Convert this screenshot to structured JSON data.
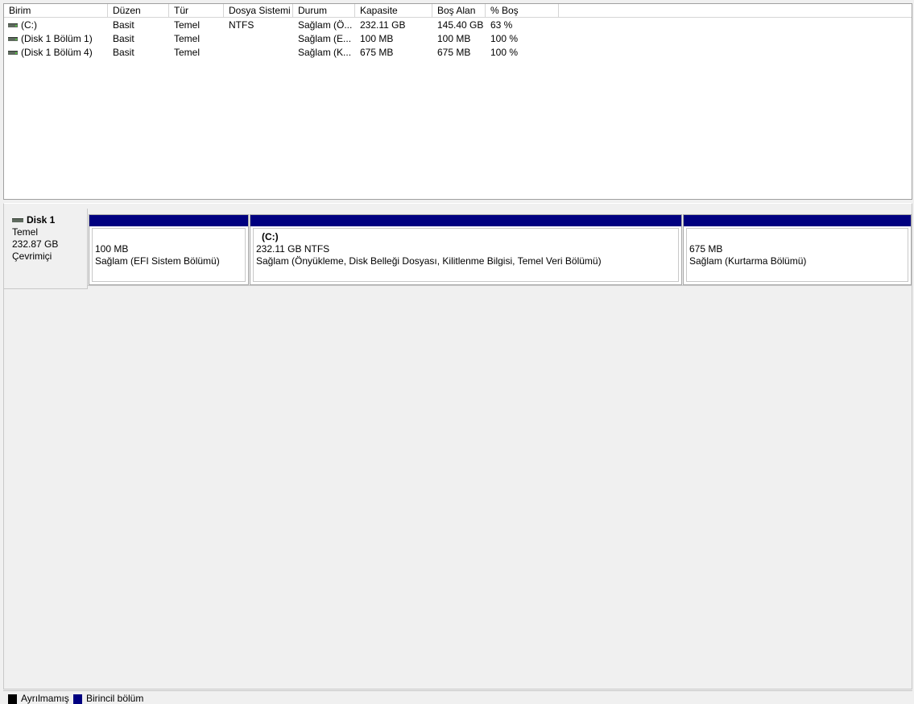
{
  "volume_list": {
    "columns": [
      "Birim",
      "Düzen",
      "Tür",
      "Dosya Sistemi",
      "Durum",
      "Kapasite",
      "Boş Alan",
      "% Boş"
    ],
    "rows": [
      {
        "icon": "volume-icon",
        "name": "(C:)",
        "layout": "Basit",
        "type": "Temel",
        "fs": "NTFS",
        "status": "Sağlam (Ö...",
        "capacity": "232.11 GB",
        "free": "145.40 GB",
        "pct_free": "63 %"
      },
      {
        "icon": "volume-icon",
        "name": "(Disk 1 Bölüm 1)",
        "layout": "Basit",
        "type": "Temel",
        "fs": "",
        "status": "Sağlam (E...",
        "capacity": "100 MB",
        "free": "100 MB",
        "pct_free": "100 %"
      },
      {
        "icon": "volume-icon",
        "name": "(Disk 1 Bölüm 4)",
        "layout": "Basit",
        "type": "Temel",
        "fs": "",
        "status": "Sağlam (K...",
        "capacity": "675 MB",
        "free": "675 MB",
        "pct_free": "100 %"
      }
    ]
  },
  "disk": {
    "icon": "disk-icon",
    "name": "Disk 1",
    "type": "Temel",
    "size": "232.87 GB",
    "state": "Çevrimiçi",
    "partitions": [
      {
        "title": "",
        "size": "100 MB",
        "status": "Sağlam (EFI Sistem Bölümü)"
      },
      {
        "title": "(C:)",
        "size": "232.11 GB NTFS",
        "status": "Sağlam (Önyükleme, Disk Belleği Dosyası, Kilitlenme Bilgisi, Temel Veri Bölümü)"
      },
      {
        "title": "",
        "size": "675 MB",
        "status": "Sağlam (Kurtarma Bölümü)"
      }
    ]
  },
  "legend": {
    "items": [
      {
        "label": "Ayrılmamış",
        "color": "#000000"
      },
      {
        "label": "Birincil bölüm",
        "color": "#000080"
      }
    ]
  },
  "colors": {
    "primary_partition": "#000080",
    "unallocated": "#000000"
  }
}
